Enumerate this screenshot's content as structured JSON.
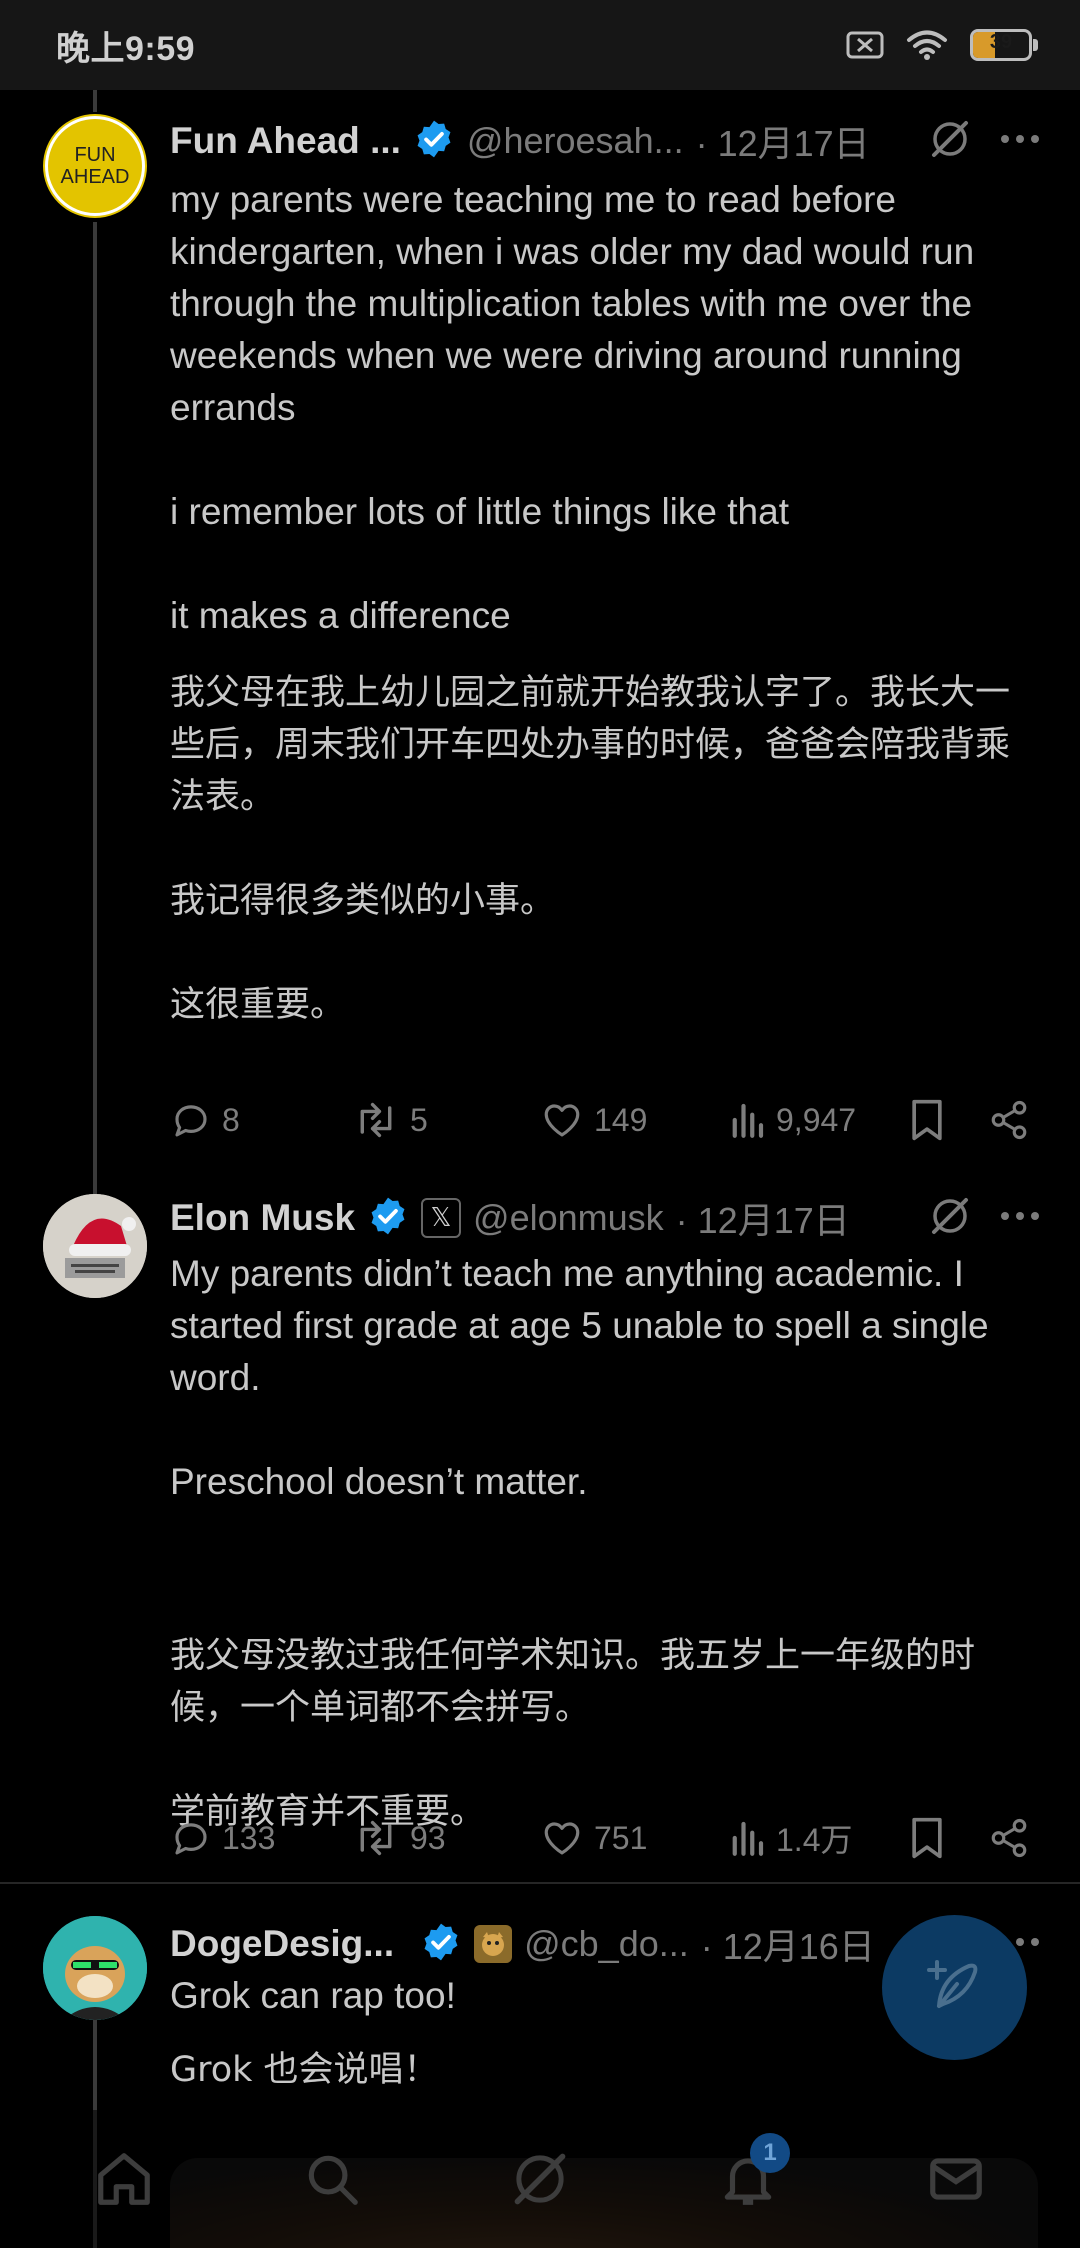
{
  "status_bar": {
    "time": "晚上9:59",
    "battery_level": "39",
    "battery_percent": 39
  },
  "posts": [
    {
      "name": "Fun Ahead ...",
      "handle": "@heroesah...",
      "date": "· 12月17日",
      "avatar_text_line1": "FUN",
      "avatar_text_line2": "AHEAD",
      "text": "my parents were teaching me to read before kindergarten, when i was older my dad would run through the multiplication tables with me over the weekends when we were driving around running errands\n\ni remember lots of little things like that\n\nit makes a difference",
      "translation": "我父母在我上幼儿园之前就开始教我认字了。我长大一些后，周末我们开车四处办事的时候，爸爸会陪我背乘法表。\n\n我记得很多类似的小事。\n\n这很重要。",
      "replies": "8",
      "reposts": "5",
      "likes": "149",
      "views": "9,947"
    },
    {
      "name": "Elon Musk",
      "handle": "@elonmusk",
      "date": "· 12月17日",
      "badge": "𝕏",
      "text": "My parents didn’t teach me anything academic. I started first grade at age 5 unable to spell a single word.\n\nPreschool doesn’t matter.",
      "translation": "我父母没教过我任何学术知识。我五岁上一年级的时候，一个单词都不会拼写。\n\n学前教育并不重要。",
      "replies": "133",
      "reposts": "93",
      "likes": "751",
      "views": "1.4万"
    },
    {
      "name": "DogeDesig...",
      "handle": "@cb_do...",
      "date": "· 12月16日",
      "text": "Grok can rap too!",
      "translation": "Grok 也会说唱！"
    }
  ],
  "nav": {
    "notification_count": "1",
    "items": [
      "home-icon",
      "search-icon",
      "grok-icon",
      "notifications-icon",
      "messages-icon"
    ]
  },
  "colors": {
    "background": "#000000",
    "verified": "#1d9bf0",
    "fab": "#0c3a63",
    "battery": "#d89a2a"
  }
}
